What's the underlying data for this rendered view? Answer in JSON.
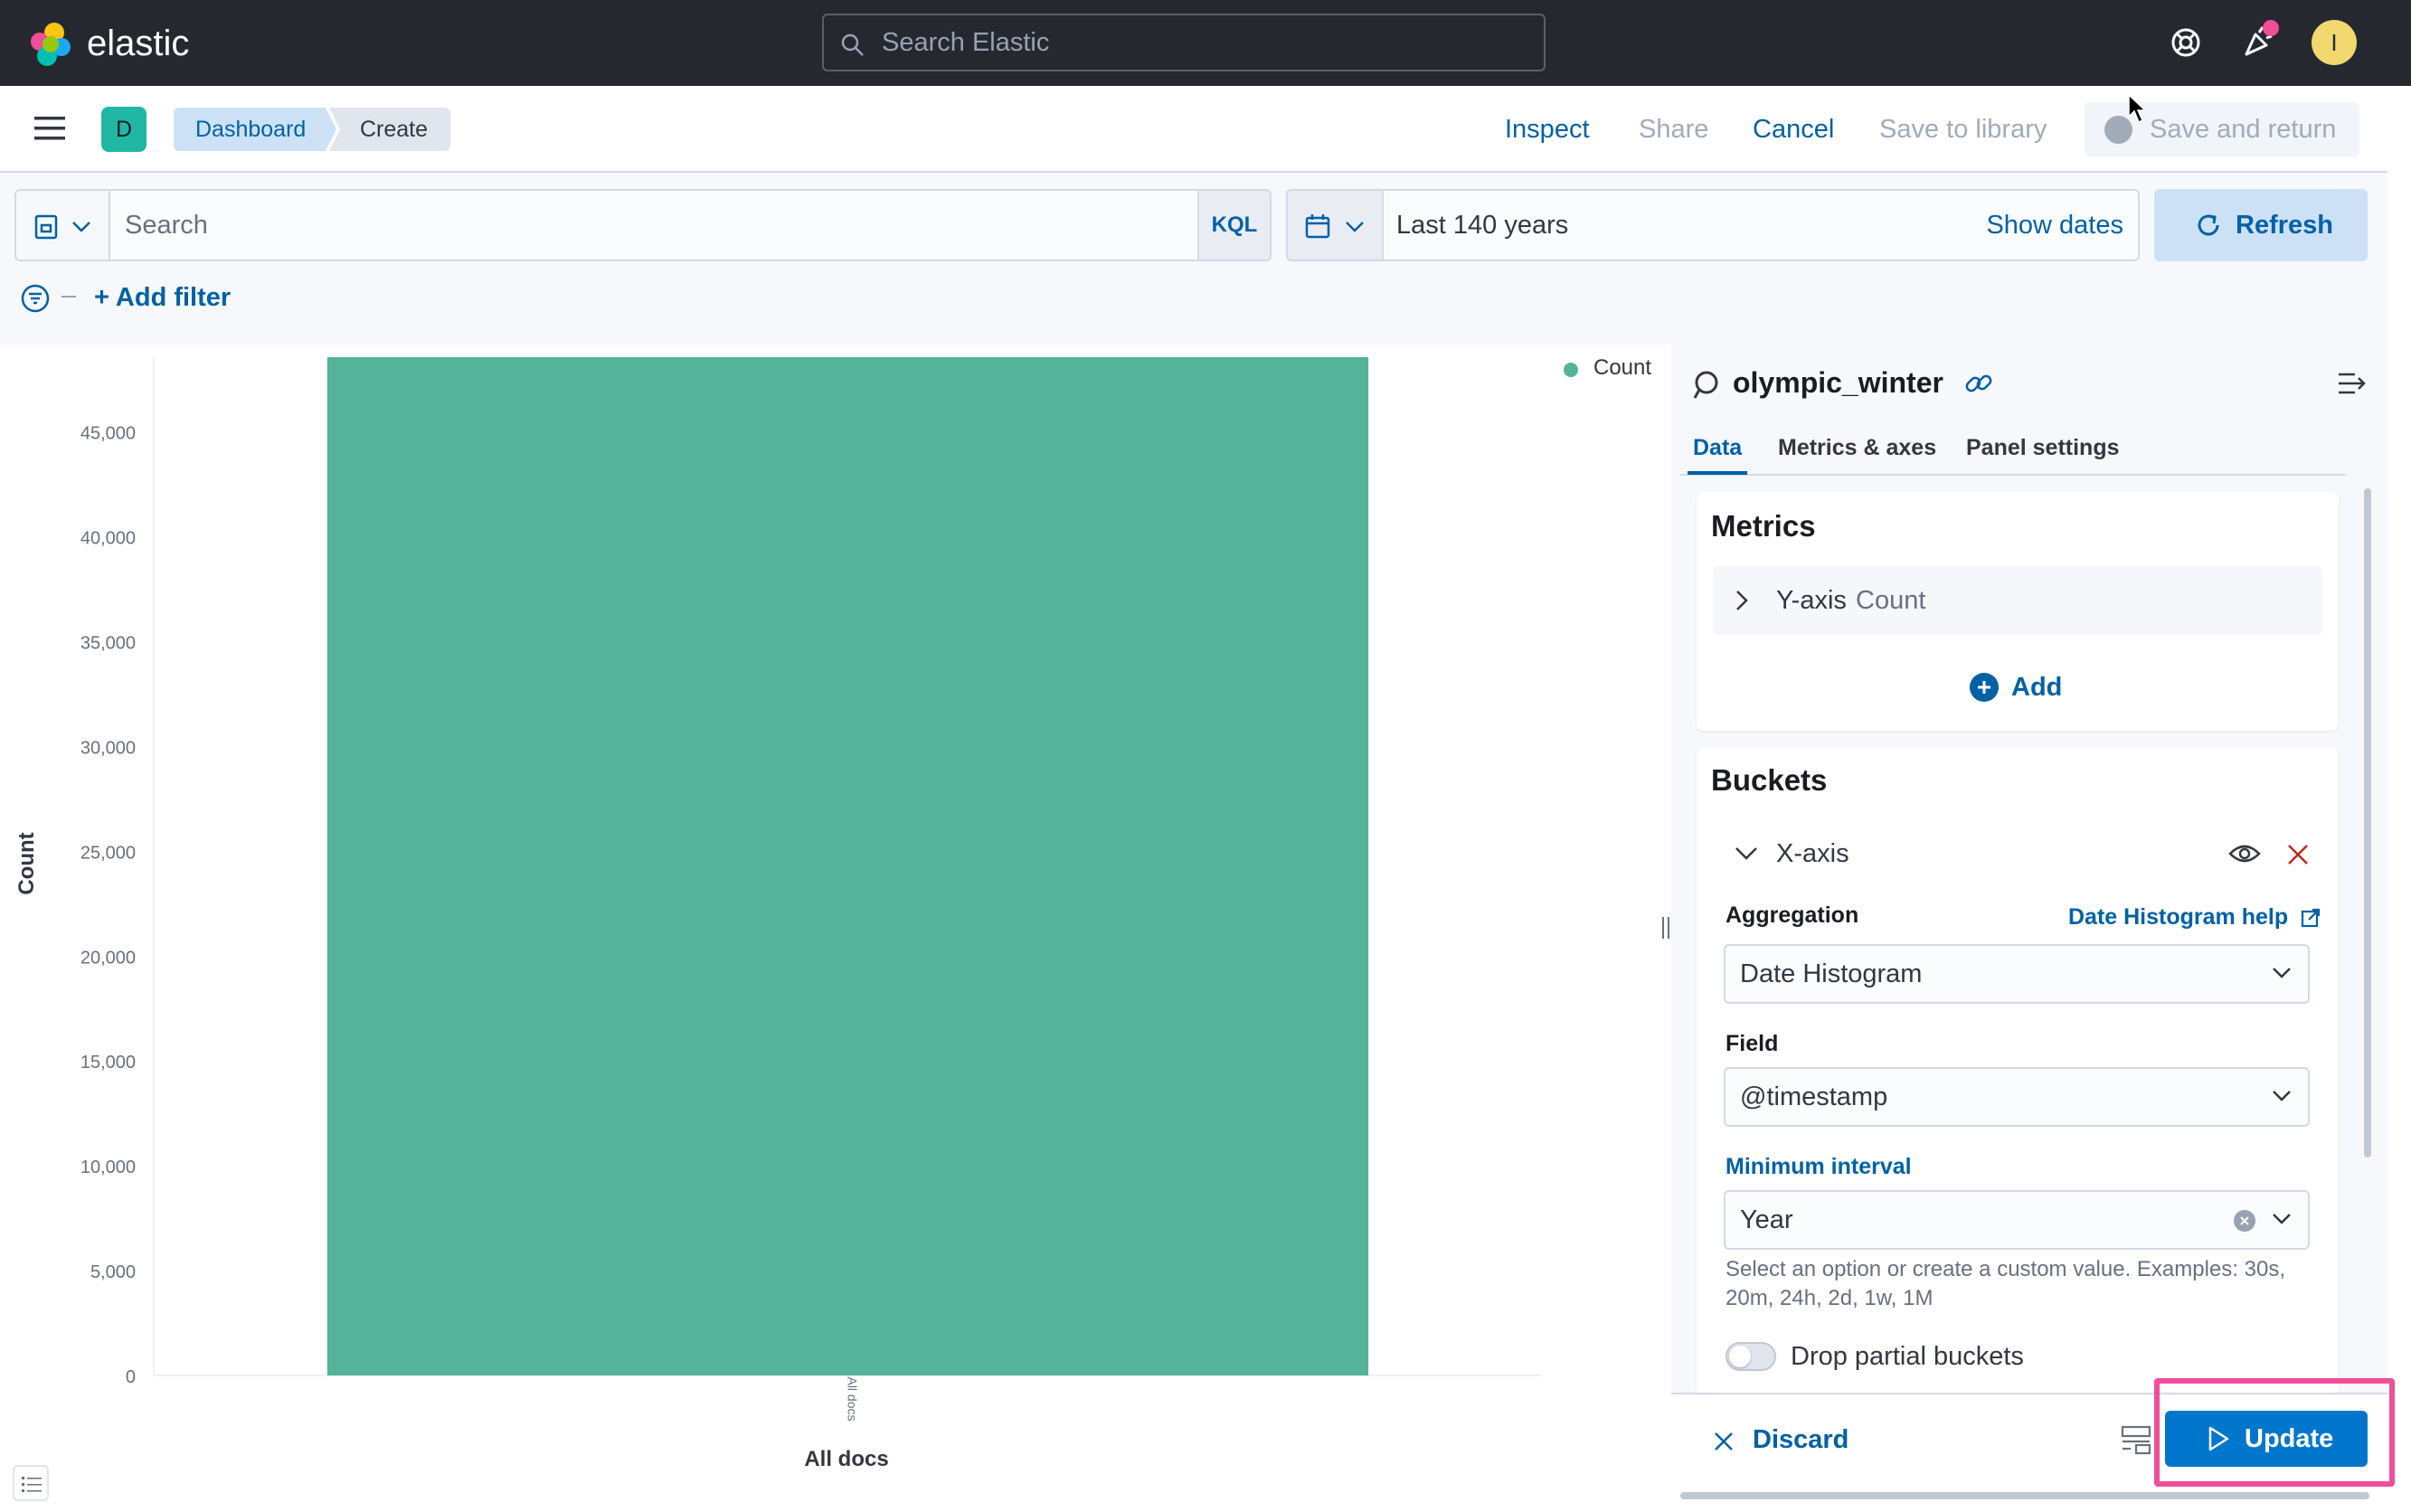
{
  "header": {
    "brand": "elastic",
    "search_placeholder": "Search Elastic",
    "user_initial": "I",
    "icons": [
      "help-icon",
      "news-feed-icon",
      "user-avatar"
    ]
  },
  "appbar": {
    "space_initial": "D",
    "breadcrumbs": [
      "Dashboard",
      "Create"
    ],
    "inspect": "Inspect",
    "share": "Share",
    "cancel": "Cancel",
    "save_to_library": "Save to library",
    "save_and_return": "Save and return"
  },
  "query": {
    "search_placeholder": "Search",
    "language": "KQL",
    "time_range": "Last 140 years",
    "show_dates": "Show dates",
    "refresh": "Refresh",
    "add_filter": "+ Add filter"
  },
  "chart_data": {
    "type": "bar",
    "categories": [
      "All docs"
    ],
    "series": [
      {
        "name": "Count",
        "values": [
          48565
        ]
      }
    ],
    "xlabel": "All docs",
    "ylabel": "Count",
    "yticks": [
      0,
      5000,
      10000,
      15000,
      20000,
      25000,
      30000,
      35000,
      40000,
      45000
    ],
    "ytick_labels": [
      "0",
      "5,000",
      "10,000",
      "15,000",
      "20,000",
      "25,000",
      "30,000",
      "35,000",
      "40,000",
      "45,000"
    ],
    "ylim": [
      0,
      48565
    ],
    "grid": false,
    "legend": "top-right",
    "colors": {
      "Count": "#54b399"
    }
  },
  "panel": {
    "index_pattern": "olympic_winter",
    "tabs": [
      "Data",
      "Metrics & axes",
      "Panel settings"
    ],
    "active_tab": "Data",
    "metrics": {
      "title": "Metrics",
      "row_label": "Y-axis",
      "row_value": "Count",
      "add": "Add"
    },
    "buckets": {
      "title": "Buckets",
      "row_label": "X-axis",
      "aggregation_label": "Aggregation",
      "help_link": "Date Histogram help",
      "aggregation_value": "Date Histogram",
      "field_label": "Field",
      "field_value": "@timestamp",
      "interval_label": "Minimum interval",
      "interval_value": "Year",
      "interval_help": "Select an option or create a custom value. Examples: 30s, 20m, 24h, 2d, 1w, 1M",
      "drop_partial": "Drop partial buckets",
      "drop_partial_enabled": false
    },
    "footer": {
      "discard": "Discard",
      "update": "Update"
    }
  },
  "colors": {
    "header_bg": "#25282f",
    "primary": "#0061a6",
    "update_button": "#0077cc",
    "highlight": "#f04e98",
    "bar": "#54b399"
  }
}
